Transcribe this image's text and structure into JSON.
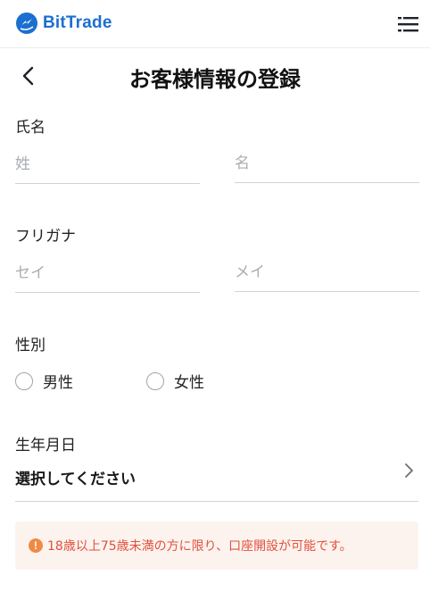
{
  "header": {
    "brand": "BitTrade",
    "brand_color": "#1b6fd0",
    "logo_icon": "bittrade-logo-icon",
    "menu_icon": "menu-icon"
  },
  "page": {
    "title": "お客様情報の登録",
    "back_icon": "chevron-left-icon"
  },
  "form": {
    "name": {
      "label": "氏名",
      "last_placeholder": "姓",
      "first_placeholder": "名"
    },
    "kana": {
      "label": "フリガナ",
      "last_placeholder": "セイ",
      "first_placeholder": "メイ"
    },
    "gender": {
      "label": "性別",
      "options": [
        "男性",
        "女性"
      ]
    },
    "birthdate": {
      "label": "生年月日",
      "value": "選択してください",
      "icon": "chevron-right-icon"
    }
  },
  "notice": {
    "icon": "warning-icon",
    "text": "18歳以上75歳未満の方に限り、口座開設が可能です。",
    "text_color": "#e0513d",
    "background": "#fdf3ee"
  }
}
